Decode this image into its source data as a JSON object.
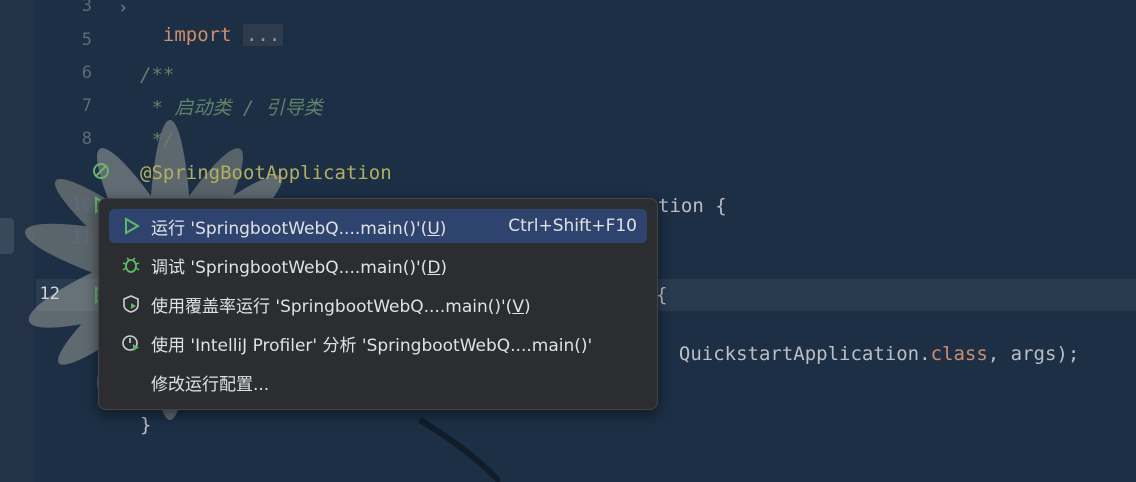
{
  "editor": {
    "line_numbers": [
      "3",
      "5",
      "6",
      "7",
      "8",
      "10",
      "11",
      "12"
    ],
    "lines": {
      "import_kw": "import",
      "import_dots": "...",
      "doc_open": "/**",
      "doc_body": " * 启动类 / 引导类",
      "doc_close": " */",
      "annotation": "@SpringBootApplication",
      "class_tail": "tion {",
      "method_tail": "{",
      "call_text": "QuickstartApplication.",
      "call_class": "class",
      "call_args": ", args);",
      "close_brace": "}"
    }
  },
  "context_menu": {
    "items": [
      {
        "label_prefix": "运行 'SpringbootWebQ....main()'(",
        "mnemonic": "U",
        "label_suffix": ")",
        "shortcut": "Ctrl+Shift+F10",
        "icon": "run-icon"
      },
      {
        "label_prefix": "调试 'SpringbootWebQ....main()'(",
        "mnemonic": "D",
        "label_suffix": ")",
        "icon": "debug-icon"
      },
      {
        "label_prefix": "使用覆盖率运行 'SpringbootWebQ....main()'(",
        "mnemonic": "V",
        "label_suffix": ")",
        "icon": "coverage-icon"
      },
      {
        "label": "使用 'IntelliJ Profiler' 分析  'SpringbootWebQ....main()'",
        "icon": "profiler-icon"
      },
      {
        "label": "修改运行配置..."
      }
    ]
  },
  "colors": {
    "selection": "#2e436e",
    "popup_bg": "#2b2d30",
    "editor_bg": "#1c2f45"
  }
}
